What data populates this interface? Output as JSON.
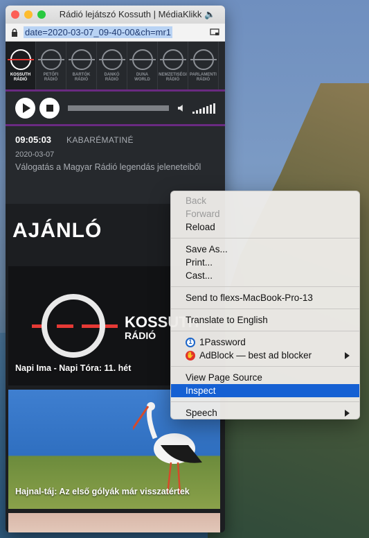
{
  "window": {
    "title": "Rádió lejátszó Kossuth | MédiaKlikk",
    "url": "date=2020-03-07_09-40-00&ch=mr1"
  },
  "stations": [
    {
      "name": "KOSSUTH",
      "sub": "RÁDIÓ"
    },
    {
      "name": "PETŐFI",
      "sub": "RÁDIÓ"
    },
    {
      "name": "BARTÓK",
      "sub": "RÁDIÓ"
    },
    {
      "name": "DANKÓ",
      "sub": "RÁDIÓ"
    },
    {
      "name": "DUNA",
      "sub": "WORLD"
    },
    {
      "name": "NEMZETISÉGI",
      "sub": "RÁDIÓ"
    },
    {
      "name": "PARLAMENTI",
      "sub": "RÁDIÓ"
    }
  ],
  "now_playing": {
    "time": "09:05:03",
    "show": "KABARÉMATINÉ",
    "date": "2020-03-07",
    "description": "Válogatás a Magyar Rádió legendás jeleneteiből"
  },
  "feed": {
    "heading": "AJÁNLÓ",
    "cards": [
      {
        "title": "Napi Ima - Napi Tóra: 11. hét",
        "logo_name": "KOSSUTH",
        "logo_sub": "RÁDIÓ"
      },
      {
        "title": "Hajnal-táj: Az első gólyák már visszatértek"
      }
    ]
  },
  "context_menu": {
    "back": "Back",
    "forward": "Forward",
    "reload": "Reload",
    "save_as": "Save As...",
    "print": "Print...",
    "cast": "Cast...",
    "send_to": "Send to flexs-MacBook-Pro-13",
    "translate": "Translate to English",
    "onepassword": "1Password",
    "adblock": "AdBlock — best ad blocker",
    "view_source": "View Page Source",
    "inspect": "Inspect",
    "speech": "Speech"
  },
  "colors": {
    "accent_purple": "#6a2a82",
    "menu_highlight": "#1560d3",
    "kossuth_red": "#e53935"
  }
}
